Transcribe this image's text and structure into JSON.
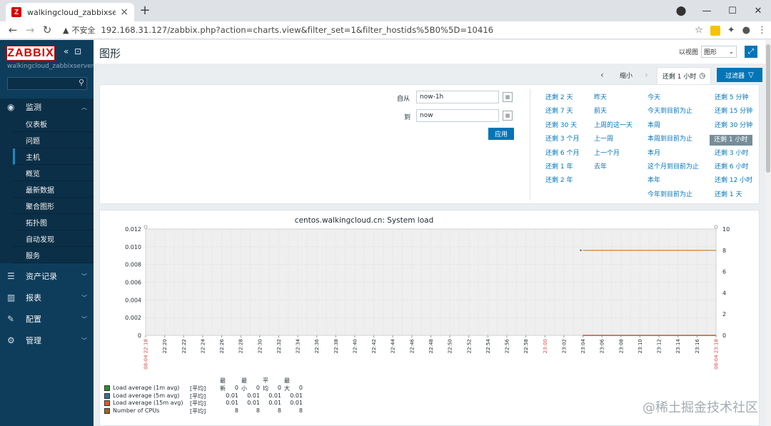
{
  "browser": {
    "tab_title": "walkingcloud_zabbixserver: 图",
    "favicon_letter": "Z",
    "insecure_label": "不安全",
    "url": "192.168.31.127/zabbix.php?action=charts.view&filter_set=1&filter_hostids%5B0%5D=10416"
  },
  "sidebar": {
    "logo": "ZABBIX",
    "server_name": "walkingcloud_zabbixserver",
    "sections": [
      {
        "label": "监测",
        "icon": "eye-icon"
      },
      {
        "label": "资产记录",
        "icon": "list-icon"
      },
      {
        "label": "报表",
        "icon": "bar-chart-icon"
      },
      {
        "label": "配置",
        "icon": "wrench-icon"
      },
      {
        "label": "管理",
        "icon": "gear-icon"
      }
    ],
    "monitoring_items": [
      "仪表板",
      "问题",
      "主机",
      "概览",
      "最新数据",
      "聚合图形",
      "拓扑图",
      "自动发现",
      "服务"
    ]
  },
  "header": {
    "title": "图形",
    "view_as_label": "以视图",
    "view_as_value": "图形"
  },
  "timebar": {
    "zoom_out": "缩小",
    "active_period": "还剩 1 小时",
    "filter_button": "过滤器"
  },
  "filter": {
    "from_label": "自从",
    "from_value": "now-1h",
    "to_label": "到",
    "to_value": "now",
    "apply_label": "应用",
    "quick_ranges": [
      [
        "还剩 2 天",
        "还剩 7 天",
        "还剩 30 天",
        "还剩 3 个月",
        "还剩 6 个月",
        "还剩 1 年",
        "还剩 2 年"
      ],
      [
        "昨天",
        "前天",
        "上周的这一天",
        "上一周",
        "上一个月",
        "去年"
      ],
      [
        "今天",
        "今天到目前为止",
        "本周",
        "本周到目前为止",
        "本月",
        "这个月到目前为止",
        "本年",
        "今年到目前为止"
      ],
      [
        "还剩 5 分钟",
        "还剩 15 分钟",
        "还剩 30 分钟",
        "还剩 1 小时",
        "还剩 3 小时",
        "还剩 6 小时",
        "还剩 12 小时",
        "还剩 1 天"
      ]
    ],
    "quick_selected": "还剩 1 小时"
  },
  "legend": {
    "headers": [
      "最新",
      "最小",
      "平均",
      "最大"
    ],
    "rows": [
      {
        "name": "Load average (1m avg)",
        "func": "[平均]",
        "values": [
          "0",
          "0",
          "0",
          "0"
        ],
        "color": "#2e8b2e"
      },
      {
        "name": "Load average (5m avg)",
        "func": "[平均]",
        "values": [
          "0.01",
          "0.01",
          "0.01",
          "0.01"
        ],
        "color": "#3a6f8f"
      },
      {
        "name": "Load average (15m avg)",
        "func": "[平均]",
        "values": [
          "0.01",
          "0.01",
          "0.01",
          "0.01"
        ],
        "color": "#e0582a"
      },
      {
        "name": "Number of CPUs",
        "func": "[平均]",
        "values": [
          "8",
          "8",
          "8",
          "8"
        ],
        "color": "#a0632a"
      }
    ]
  },
  "chart_data": {
    "type": "line",
    "title": "centos.walkingcloud.cn: System load",
    "x": [
      "22:18",
      "22:20",
      "22:22",
      "22:24",
      "22:26",
      "22:28",
      "22:30",
      "22:32",
      "22:34",
      "22:36",
      "22:38",
      "22:40",
      "22:42",
      "22:44",
      "22:46",
      "22:48",
      "22:50",
      "22:52",
      "22:54",
      "22:56",
      "22:58",
      "23:00",
      "23:02",
      "23:04",
      "23:06",
      "23:08",
      "23:10",
      "23:12",
      "23:14",
      "23:16",
      "23:18"
    ],
    "x_start_label": "08-04 22:18",
    "x_end_label": "08-04 23:18",
    "x_red_labels": [
      "23:00"
    ],
    "y_left_ticks": [
      "0",
      "0.002",
      "0.004",
      "0.006",
      "0.008",
      "0.010",
      "0.012"
    ],
    "y_left_range": [
      0,
      0.012
    ],
    "y_right_ticks": [
      "0",
      "2",
      "4",
      "6",
      "8",
      "10"
    ],
    "y_right_range": [
      0,
      10
    ],
    "series": [
      {
        "name": "Load average (1m avg)",
        "axis": "left",
        "color": "#2e8b2e",
        "from": "23:04",
        "to": "23:18",
        "value": 0
      },
      {
        "name": "Load average (5m avg)",
        "axis": "left",
        "color": "#3a6f8f",
        "from": "23:04",
        "to": "23:18",
        "value": 0
      },
      {
        "name": "Load average (15m avg)",
        "axis": "left",
        "color": "#e0582a",
        "from": "23:04",
        "to": "23:18",
        "value": 0
      },
      {
        "name": "Number of CPUs",
        "axis": "right",
        "color": "#d58b45",
        "from": "23:04",
        "to": "23:18",
        "value": 8
      }
    ],
    "grid": true
  },
  "watermark": "@稀土掘金技术社区"
}
